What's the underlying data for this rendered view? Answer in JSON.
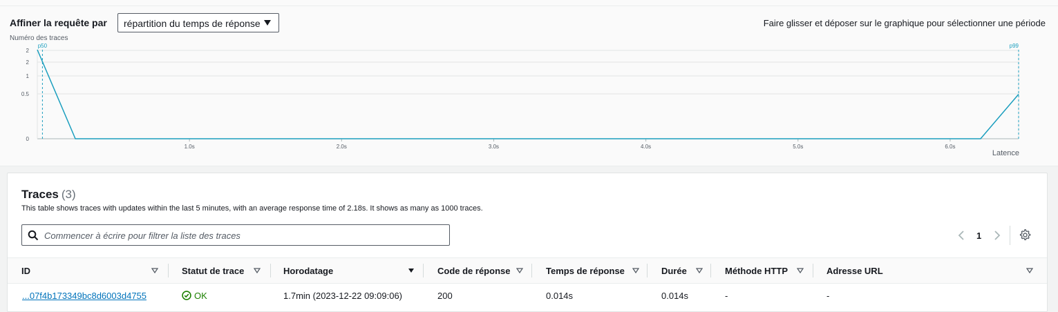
{
  "refine": {
    "label": "Affiner la requête par",
    "selected": "répartition du temps de réponse",
    "hint": "Faire glisser et déposer sur le graphique pour sélectionner une période"
  },
  "chart_data": {
    "type": "line",
    "ylabel": "Numéro des traces",
    "xlabel": "Latence",
    "y_ticks": [
      "0",
      "0.5",
      "1",
      "2",
      "2"
    ],
    "x_ticks": [
      "1.0s",
      "2.0s",
      "3.0s",
      "4.0s",
      "5.0s",
      "6.0s"
    ],
    "xlim": [
      0,
      6.45
    ],
    "ylim": [
      0,
      2
    ],
    "x": [
      0.0,
      0.25,
      6.2,
      6.45
    ],
    "y": [
      2,
      0,
      0,
      1
    ],
    "markers": [
      {
        "label": "p50",
        "x": 0.02
      },
      {
        "label": "p99",
        "x": 6.45
      }
    ],
    "line_color": "#1a9ebe"
  },
  "traces": {
    "title": "Traces",
    "count": "(3)",
    "description": "This table shows traces with updates within the last 5 minutes, with an average response time of 2.18s. It shows as many as 1000 traces.",
    "filter_placeholder": "Commencer à écrire pour filtrer la liste des traces",
    "page": "1",
    "columns": [
      "ID",
      "Statut de trace",
      "Horodatage",
      "Code de réponse",
      "Temps de réponse",
      "Durée",
      "Méthode HTTP",
      "Adresse URL"
    ],
    "rows": [
      {
        "id": "...07f4b173349bc8d6003d4755",
        "status": "OK",
        "timestamp": "1.7min (2023-12-22 09:09:06)",
        "code": "200",
        "response_time": "0.014s",
        "duration": "0.014s",
        "method": "-",
        "url": "-"
      }
    ]
  }
}
